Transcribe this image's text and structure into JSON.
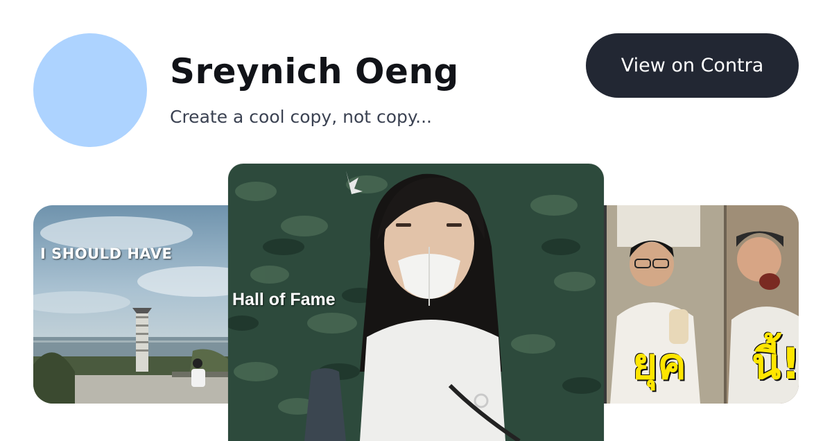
{
  "profile": {
    "name": "Sreynich Oeng",
    "tagline": "Create a cool copy, not copy...",
    "avatar_color": "#add3ff"
  },
  "cta": {
    "label": "View on Contra",
    "background": "#222733"
  },
  "projects": [
    {
      "id": "left",
      "overlay_text": "I SHOULD HAVE"
    },
    {
      "id": "center",
      "overlay_text": "Hall of Fame"
    },
    {
      "id": "right",
      "overlay_text_1": "ยุค",
      "overlay_text_2": "นี้!"
    }
  ]
}
